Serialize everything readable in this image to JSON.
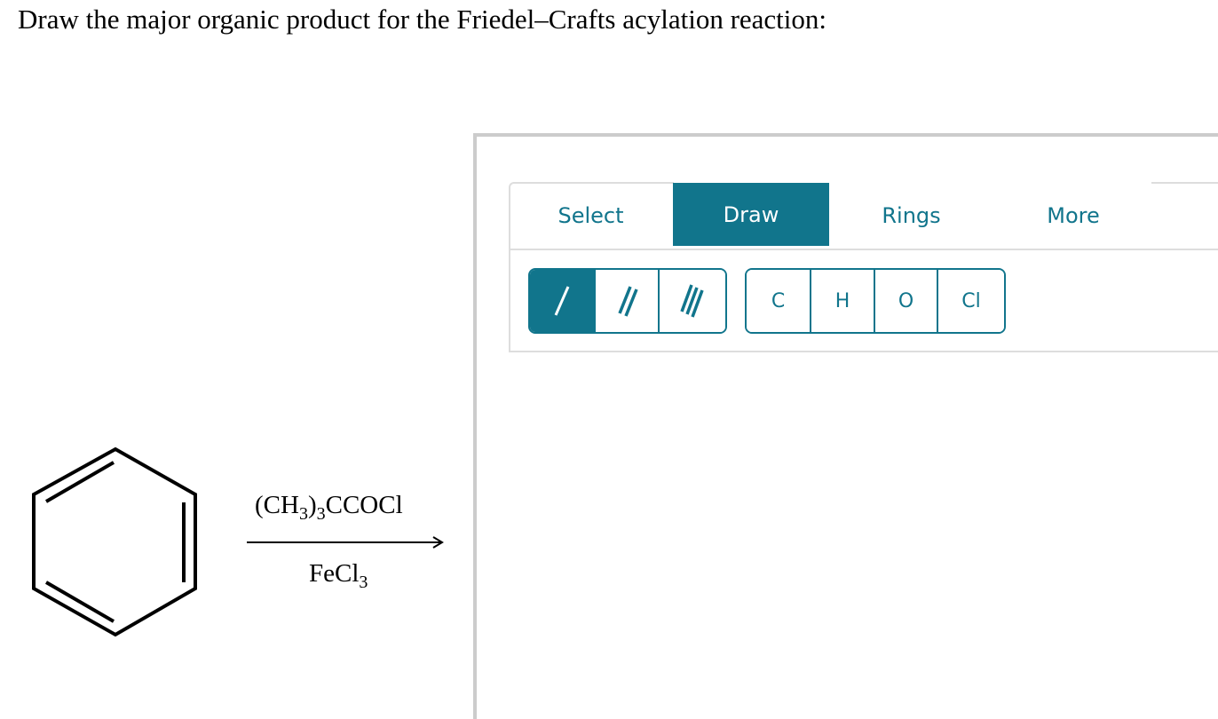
{
  "question": "Draw the major organic product for the Friedel–Crafts acylation reaction:",
  "reaction": {
    "reactant": "benzene",
    "reagent_above": {
      "pre": "(CH",
      "sub1": "3",
      "mid": ")",
      "sub2": "3",
      "post": "CCOCl"
    },
    "reagent_below": {
      "pre": "FeCl",
      "sub": "3"
    }
  },
  "editor": {
    "tabs": [
      {
        "label": "Select",
        "active": false
      },
      {
        "label": "Draw",
        "active": true
      },
      {
        "label": "Rings",
        "active": false
      },
      {
        "label": "More",
        "active": false
      }
    ],
    "bond_tools": [
      {
        "icon": "single-bond-icon",
        "active": true
      },
      {
        "icon": "double-bond-icon",
        "active": false
      },
      {
        "icon": "triple-bond-icon",
        "active": false
      }
    ],
    "atoms": [
      "C",
      "H",
      "O",
      "Cl"
    ],
    "accent_color": "#11758c",
    "border_color": "#cccccc"
  }
}
